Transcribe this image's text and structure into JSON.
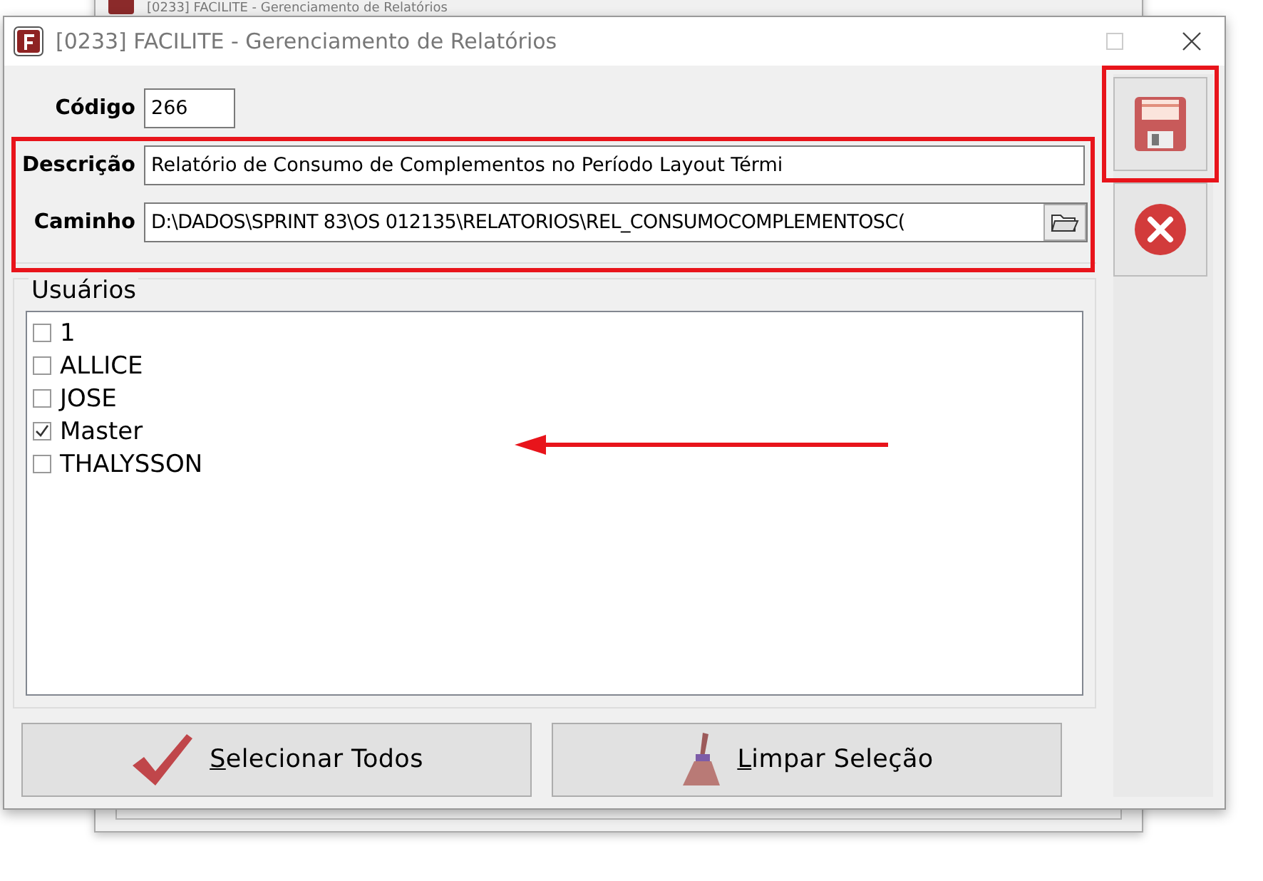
{
  "background_window": {
    "title": "[0233] FACILITE - Gerenciamento de Relatórios"
  },
  "window": {
    "title": "[0233] FACILITE - Gerenciamento de Relatórios"
  },
  "form": {
    "codigo": {
      "label": "Código",
      "value": "266"
    },
    "descricao": {
      "label": "Descrição",
      "value": "Relatório de Consumo de Complementos no Período Layout Térmi"
    },
    "caminho": {
      "label": "Caminho",
      "value": "D:\\DADOS\\SPRINT 83\\OS 012135\\RELATORIOS\\REL_CONSUMOCOMPLEMENTOSC("
    }
  },
  "users": {
    "title": "Usuários",
    "items": [
      {
        "label": "1",
        "checked": false
      },
      {
        "label": "ALLICE",
        "checked": false
      },
      {
        "label": "JOSE",
        "checked": false
      },
      {
        "label": "Master",
        "checked": true
      },
      {
        "label": "THALYSSON",
        "checked": false
      }
    ]
  },
  "buttons": [
    {
      "kind": "select_all",
      "label": "Selecionar Todos"
    },
    {
      "kind": "clear",
      "label": "Limpar Seleção"
    }
  ]
}
